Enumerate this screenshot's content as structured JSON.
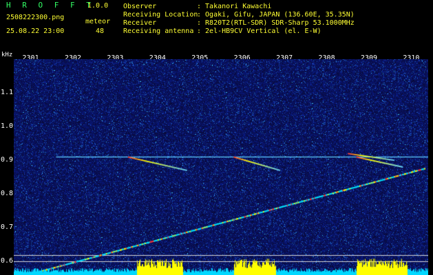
{
  "header": {
    "app_title": "H R O F F T",
    "app_version": "1.0.0",
    "filename": "2508222300.png",
    "meteor_label": "meteor",
    "datetime": "25.08.22 23:00",
    "meteor_count": "48",
    "info": [
      {
        "key": "Observer",
        "value": ": Takanori Kawachi"
      },
      {
        "key": "Receiving Location",
        "value": ": Ogaki, Gifu, JAPAN (136.60E, 35.35N)"
      },
      {
        "key": "Receiver",
        "value": ": R820T2(RTL-SDR) SDR-Sharp 53.1000MHz"
      },
      {
        "key": "Receiving antenna",
        "value": ": 2el-HB9CV Vertical (el. E-W)"
      }
    ]
  },
  "spectrogram": {
    "y_unit": "kHz",
    "x_ticks": [
      "2301",
      "2302",
      "2303",
      "2304",
      "2305",
      "2306",
      "2307",
      "2308",
      "2309",
      "2310"
    ],
    "y_ticks": [
      "1.1",
      "1.0",
      "0.9",
      "0.8",
      "0.7",
      "0.6"
    ],
    "y_tick_values": [
      1.1,
      1.0,
      0.9,
      0.8,
      0.7,
      0.6
    ],
    "x_range": [
      2300.6,
      2310.4
    ],
    "y_range": [
      0.56,
      1.2
    ],
    "carrier_khz": 0.91,
    "ref_lines_khz": [
      0.62,
      0.6
    ],
    "colors": {
      "background": "#000000",
      "noise_dark": "#0a0a3a",
      "noise_mid": "#1a2a8a",
      "text_white": "#ffffff",
      "text_yellow": "#ffff33",
      "title_green": "#33ff66",
      "carrier": "#5fd0ff",
      "signal_cyan": "#00e5ff",
      "signal_yellow": "#ffff00",
      "signal_red": "#ff3333"
    },
    "meteor_trails": [
      {
        "x": [
          2303.3,
          2304.7
        ],
        "y": [
          0.91,
          0.87
        ]
      },
      {
        "x": [
          2305.8,
          2306.9
        ],
        "y": [
          0.91,
          0.87
        ]
      },
      {
        "x": [
          2308.7,
          2309.8
        ],
        "y": [
          0.91,
          0.88
        ]
      },
      {
        "x": [
          2308.5,
          2309.6
        ],
        "y": [
          0.92,
          0.9
        ]
      }
    ],
    "sweep": {
      "x": [
        2300.9,
        2310.3
      ],
      "y": [
        0.56,
        0.875
      ]
    }
  }
}
